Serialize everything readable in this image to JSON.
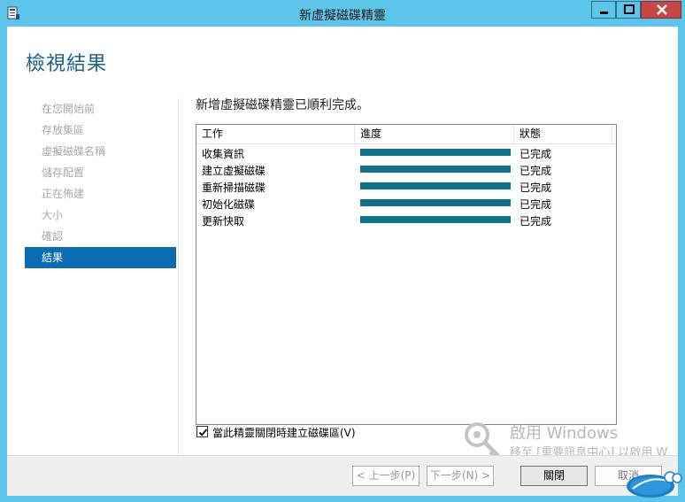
{
  "window": {
    "title": "新虛擬磁碟精靈",
    "app_icon": "server-manager-icon",
    "controls": {
      "minimize": "minimize-icon",
      "maximize": "maximize-icon",
      "close": "close-icon"
    }
  },
  "page": {
    "title": "檢視結果"
  },
  "nav": {
    "items": [
      {
        "label": "在您開始前",
        "state": "disabled"
      },
      {
        "label": "存放集區",
        "state": "disabled"
      },
      {
        "label": "虛擬磁碟名稱",
        "state": "disabled"
      },
      {
        "label": "儲存配置",
        "state": "disabled"
      },
      {
        "label": "正在佈建",
        "state": "disabled"
      },
      {
        "label": "大小",
        "state": "disabled"
      },
      {
        "label": "確認",
        "state": "disabled"
      },
      {
        "label": "結果",
        "state": "active"
      }
    ]
  },
  "result": {
    "message": "新增虛擬磁碟精靈已順利完成。"
  },
  "table": {
    "columns": [
      "工作",
      "進度",
      "狀態"
    ],
    "rows": [
      {
        "task": "收集資訊",
        "progress": 1.0,
        "status": "已完成"
      },
      {
        "task": "建立虛擬磁碟",
        "progress": 1.0,
        "status": "已完成"
      },
      {
        "task": "重新掃描磁碟",
        "progress": 1.0,
        "status": "已完成"
      },
      {
        "task": "初始化磁碟",
        "progress": 1.0,
        "status": "已完成"
      },
      {
        "task": "更新快取",
        "progress": 1.0,
        "status": "已完成"
      }
    ]
  },
  "options": {
    "create_volume_label": "當此精靈關閉時建立磁碟區(V)",
    "create_volume_checked": true
  },
  "buttons": {
    "prev": "< 上一步(P)",
    "next": "下一步(N) >",
    "close": "關閉",
    "cancel": "取消"
  },
  "watermark": {
    "line1": "啟用 Windows",
    "line2": "移至 [重要訊息中心] 以啟用 W"
  },
  "colors": {
    "frame": "#5ec5ea",
    "accent": "#0a6cb3",
    "progress": "#0e7389",
    "title": "#1e5f86"
  }
}
